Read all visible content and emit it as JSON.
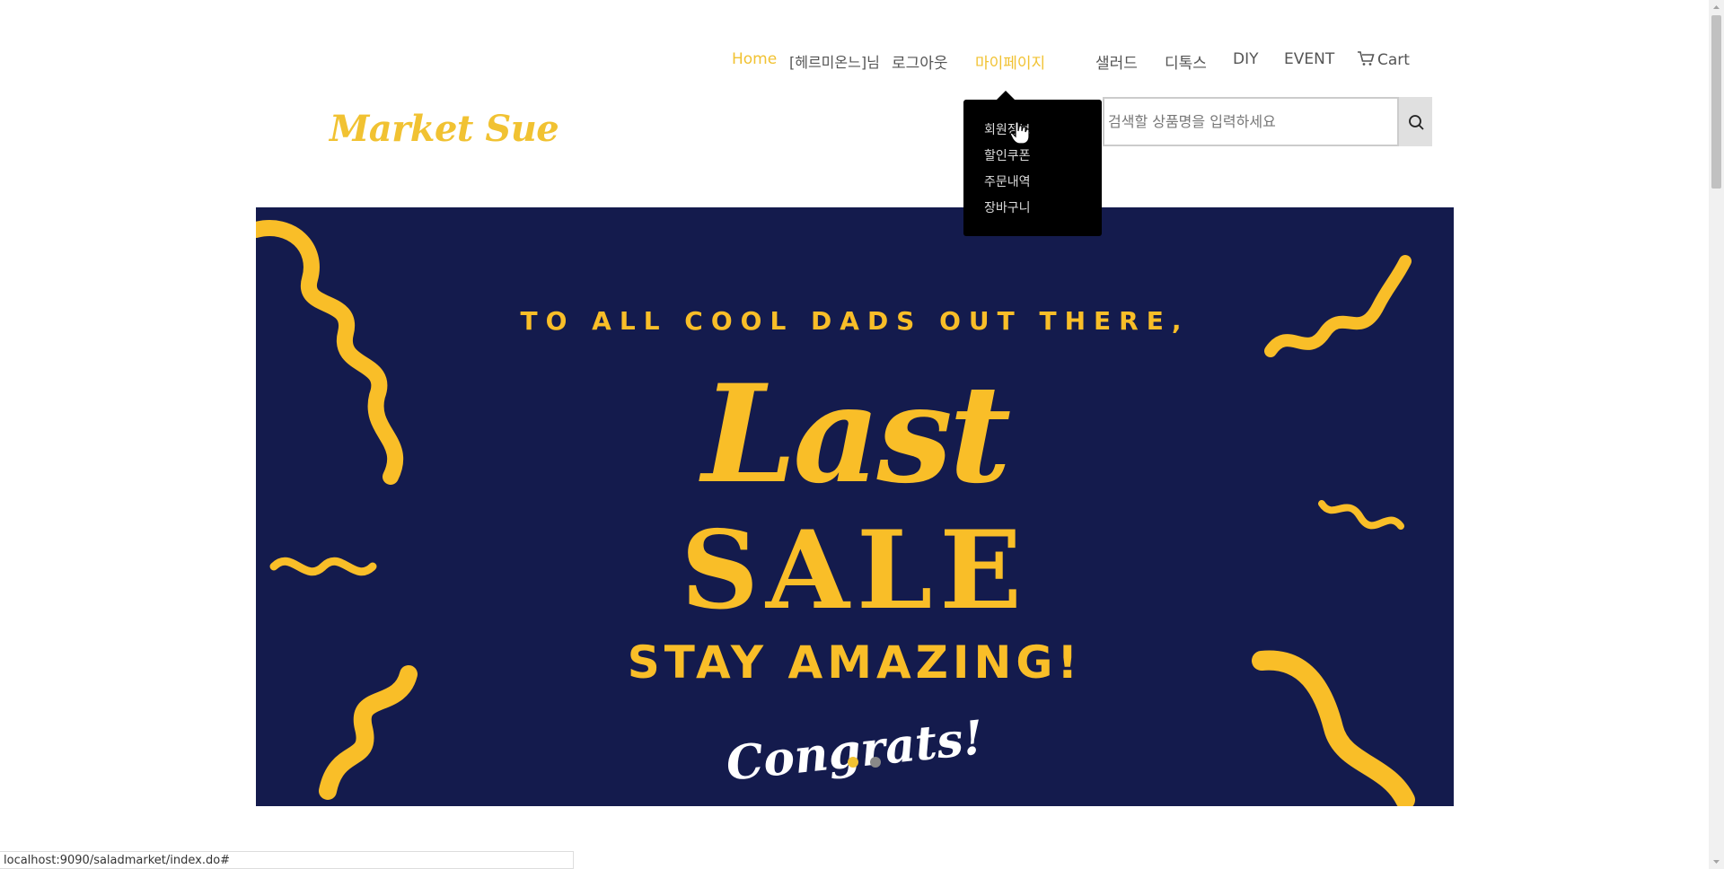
{
  "nav": {
    "home": "Home",
    "user": "[헤르미온느]님",
    "logout": "로그아웃",
    "mypage": "마이페이지",
    "salad": "샐러드",
    "detox": "디톡스",
    "diy": "DIY",
    "event": "EVENT",
    "cart": "Cart"
  },
  "logo": "Market Sue",
  "search": {
    "placeholder": "검색할 상품명을 입력하세요"
  },
  "dropdown": {
    "items": [
      "회원정보",
      "할인쿠폰",
      "주문내역",
      "장바구니"
    ]
  },
  "banner": {
    "line1": "TO ALL COOL DADS OUT THERE,",
    "line2": "Last",
    "line3": "SALE",
    "line4": "STAY AMAZING!",
    "line5": "Congrats!",
    "slide_count": 2,
    "active_slide": 1
  },
  "status_url": "localhost:9090/saladmarket/index.do#",
  "colors": {
    "accent": "#f1c232",
    "banner_bg": "#141b4d",
    "banner_text": "#f9be28"
  }
}
